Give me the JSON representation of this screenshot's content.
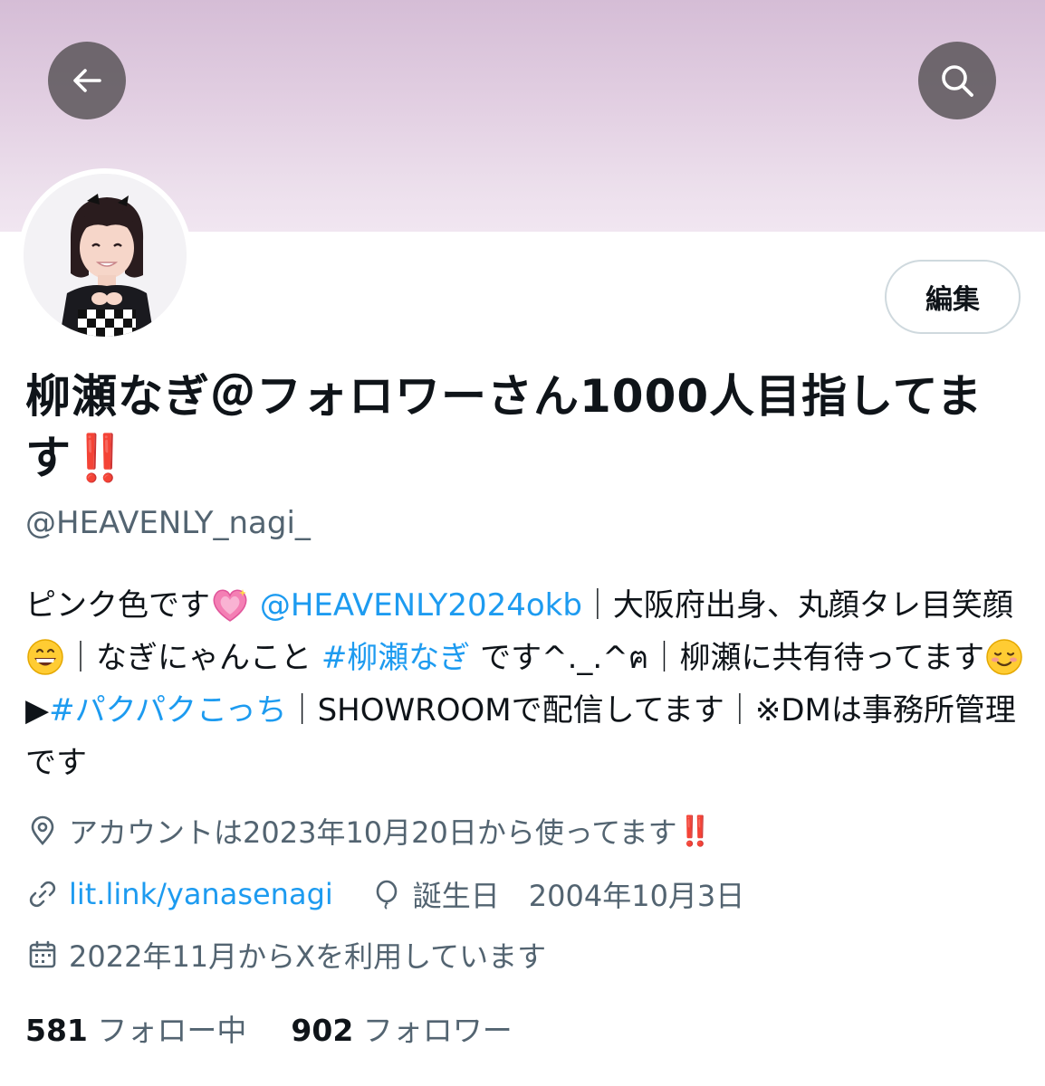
{
  "header": {
    "back_icon": "arrow-left-icon",
    "search_icon": "search-icon",
    "banner_color": "#e2cfe2"
  },
  "profile": {
    "edit_label": "編集",
    "display_name": "柳瀬なぎ＠フォロワーさん1000人目指してます",
    "display_name_emoji": "‼️",
    "handle": "@HEAVENLY_nagi_"
  },
  "bio": {
    "p1": "ピンク色です",
    "mention": "@HEAVENLY2024okb",
    "p2": "｜大阪府出身、丸顔タレ目笑顔",
    "p3": "｜なぎにゃんこと",
    "hashtag1": "#柳瀬なぎ",
    "p4": "です^._.^ฅ｜柳瀬に共有待ってます",
    "p5": "▶",
    "hashtag2": "#パクパクこっち",
    "p6": "｜SHOWROOMで配信してます｜※DMは事務所管理です"
  },
  "meta": {
    "location": "アカウントは2023年10月20日から使ってます",
    "location_emoji": "‼️",
    "link": "lit.link/yanasenagi",
    "birthday": "誕生日　2004年10月3日",
    "joined": "2022年11月からXを利用しています"
  },
  "stats": {
    "following_count": "581",
    "following_label": "フォロー中",
    "followers_count": "902",
    "followers_label": "フォロワー"
  },
  "colors": {
    "link": "#1d9bf0",
    "secondary_text": "#536471",
    "primary_text": "#0f1419",
    "alert": "#e0242c"
  }
}
